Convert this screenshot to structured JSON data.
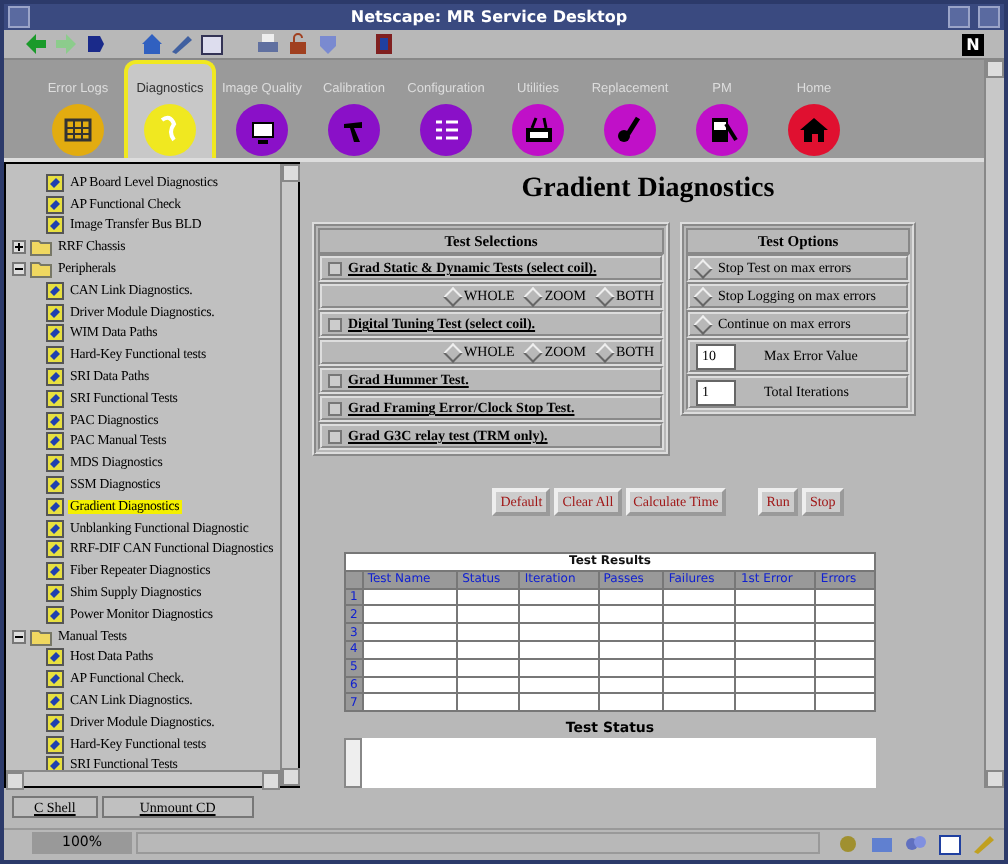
{
  "window": {
    "title": "Netscape: MR Service Desktop"
  },
  "logo": "N",
  "nav": [
    {
      "label": "Error Logs",
      "color": "#e2ac10",
      "selected": false
    },
    {
      "label": "Diagnostics",
      "color": "#f0e820",
      "selected": true
    },
    {
      "label": "Image Quality",
      "color": "#8a10c8",
      "selected": false
    },
    {
      "label": "Calibration",
      "color": "#8a10c8",
      "selected": false
    },
    {
      "label": "Configuration",
      "color": "#8a10c8",
      "selected": false
    },
    {
      "label": "Utilities",
      "color": "#c010c8",
      "selected": false
    },
    {
      "label": "Replacement",
      "color": "#c010c8",
      "selected": false
    },
    {
      "label": "PM",
      "color": "#c010c8",
      "selected": false
    },
    {
      "label": "Home",
      "color": "#e01030",
      "selected": false
    }
  ],
  "tree": [
    {
      "kind": "test",
      "label": "AP Board Level Diagnostics",
      "selected": false
    },
    {
      "kind": "test",
      "label": "AP Functional Check",
      "selected": false
    },
    {
      "kind": "test",
      "label": "Image Transfer Bus BLD",
      "selected": false
    },
    {
      "kind": "folder",
      "label": "RRF Chassis",
      "expanded": false
    },
    {
      "kind": "folder",
      "label": "Peripherals",
      "expanded": true,
      "children": [
        {
          "kind": "test",
          "label": "CAN Link Diagnostics.",
          "selected": false
        },
        {
          "kind": "test",
          "label": "Driver Module Diagnostics.",
          "selected": false
        },
        {
          "kind": "test",
          "label": "WIM Data Paths",
          "selected": false
        },
        {
          "kind": "test",
          "label": "Hard-Key Functional tests",
          "selected": false
        },
        {
          "kind": "test",
          "label": "SRI Data Paths",
          "selected": false
        },
        {
          "kind": "test",
          "label": "SRI Functional Tests",
          "selected": false
        },
        {
          "kind": "test",
          "label": "PAC Diagnostics",
          "selected": false
        },
        {
          "kind": "test",
          "label": "PAC Manual Tests",
          "selected": false
        },
        {
          "kind": "test",
          "label": "MDS Diagnostics",
          "selected": false
        },
        {
          "kind": "test",
          "label": "SSM Diagnostics",
          "selected": false
        },
        {
          "kind": "test",
          "label": "Gradient Diagnostics",
          "selected": true
        },
        {
          "kind": "test",
          "label": "Unblanking Functional Diagnostic",
          "selected": false
        },
        {
          "kind": "test",
          "label": "RRF-DIF CAN Functional Diagnostics",
          "selected": false
        },
        {
          "kind": "test",
          "label": "Fiber Repeater Diagnostics",
          "selected": false
        },
        {
          "kind": "test",
          "label": "Shim Supply Diagnostics",
          "selected": false
        },
        {
          "kind": "test",
          "label": "Power Monitor Diagnostics",
          "selected": false
        }
      ]
    },
    {
      "kind": "folder",
      "label": "Manual Tests",
      "expanded": true,
      "children": [
        {
          "kind": "test",
          "label": "Host Data Paths",
          "selected": false
        },
        {
          "kind": "test",
          "label": "AP Functional Check.",
          "selected": false
        },
        {
          "kind": "test",
          "label": "CAN Link Diagnostics.",
          "selected": false
        },
        {
          "kind": "test",
          "label": "Driver Module Diagnostics.",
          "selected": false
        },
        {
          "kind": "test",
          "label": "Hard-Key Functional tests",
          "selected": false
        },
        {
          "kind": "test",
          "label": "SRI Functional Tests",
          "selected": false
        }
      ]
    }
  ],
  "heading": "Gradient Diagnostics",
  "test_selections": {
    "title": "Test Selections",
    "rows": [
      {
        "kind": "checkbox",
        "label": "Grad Static & Dynamic Tests (select coil).",
        "checked": false
      },
      {
        "kind": "radios",
        "options": [
          {
            "label": "WHOLE",
            "selected": false
          },
          {
            "label": "ZOOM",
            "selected": false
          },
          {
            "label": "BOTH",
            "selected": false
          }
        ]
      },
      {
        "kind": "checkbox",
        "label": "Digital Tuning Test (select coil).",
        "checked": false
      },
      {
        "kind": "radios",
        "options": [
          {
            "label": "WHOLE",
            "selected": false
          },
          {
            "label": "ZOOM",
            "selected": false
          },
          {
            "label": "BOTH",
            "selected": false
          }
        ]
      },
      {
        "kind": "checkbox",
        "label": "Grad Hummer Test.",
        "checked": false
      },
      {
        "kind": "checkbox",
        "label": "Grad Framing Error/Clock Stop Test.",
        "checked": false
      },
      {
        "kind": "checkbox",
        "label": "Grad G3C relay test (TRM only).",
        "checked": false
      }
    ]
  },
  "test_options": {
    "title": "Test Options",
    "rows": [
      {
        "kind": "radio",
        "label": "Stop Test on max errors",
        "selected": false
      },
      {
        "kind": "radio",
        "label": "Stop Logging on max errors",
        "selected": false
      },
      {
        "kind": "radio",
        "label": "Continue on max errors",
        "selected": false
      }
    ],
    "fields": [
      {
        "label": "Max Error Value",
        "value": "10"
      },
      {
        "label": "Total Iterations",
        "value": "1"
      }
    ]
  },
  "button_groups": [
    [
      "Default",
      "Clear All",
      "Calculate Time"
    ],
    [
      "Run",
      "Stop"
    ]
  ],
  "results": {
    "title": "Test Results",
    "columns": [
      "Test Name",
      "Status",
      "Iteration",
      "Passes",
      "Failures",
      "1st Error",
      "Errors"
    ],
    "rows": [
      "1",
      "2",
      "3",
      "4",
      "5",
      "6",
      "7"
    ]
  },
  "status_title": "Test Status",
  "bottom_buttons": [
    "C Shell",
    "Unmount CD"
  ],
  "status_bar": {
    "progress": "100%"
  }
}
